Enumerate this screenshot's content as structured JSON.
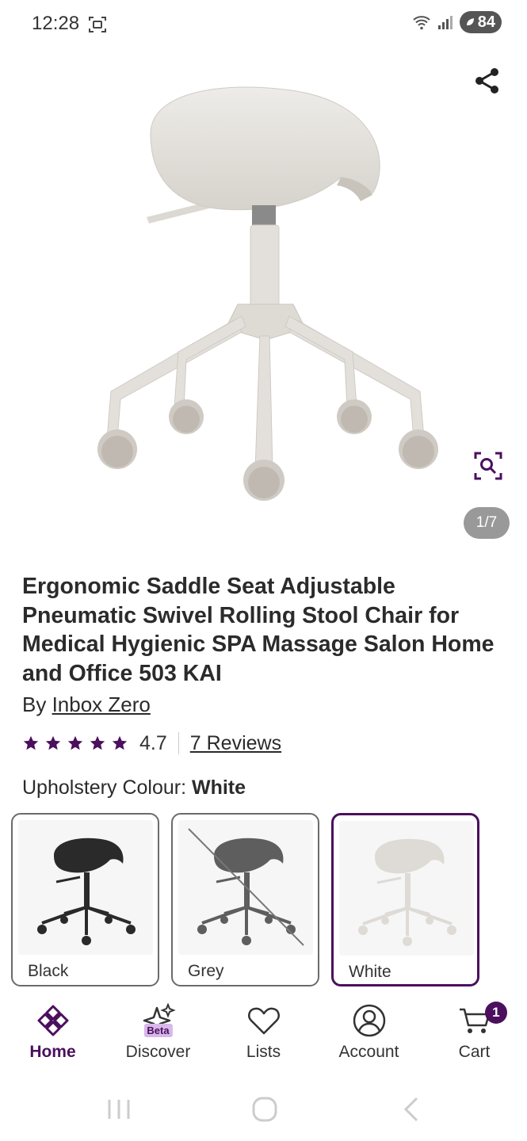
{
  "status_bar": {
    "time": "12:28",
    "battery": "84"
  },
  "gallery": {
    "counter": "1/7"
  },
  "product": {
    "title": "Ergonomic Saddle Seat Adjustable Pneumatic Swivel Rolling Stool Chair for Medical Hygienic SPA Massage Salon Home and Office 503 KAI",
    "by_prefix": "By ",
    "brand": "Inbox Zero",
    "rating": "4.7",
    "star_count": 5,
    "reviews_label": "7 Reviews"
  },
  "options": {
    "label": "Upholstery Colour: ",
    "selected": "White",
    "swatches": [
      {
        "label": "Black",
        "chair_color": "#2a2a2a",
        "available": true,
        "selected": false
      },
      {
        "label": "Grey",
        "chair_color": "#5e5e5e",
        "available": false,
        "selected": false
      },
      {
        "label": "White",
        "chair_color": "#dedbd6",
        "available": true,
        "selected": true
      }
    ]
  },
  "bottom_nav": {
    "items": [
      {
        "label": "Home",
        "active": true
      },
      {
        "label": "Discover",
        "badge": "Beta"
      },
      {
        "label": "Lists"
      },
      {
        "label": "Account"
      },
      {
        "label": "Cart",
        "badge": "1"
      }
    ]
  },
  "colors": {
    "brand": "#4b0f5e",
    "counter_bg": "#999999",
    "chair": "#e3e0db"
  }
}
